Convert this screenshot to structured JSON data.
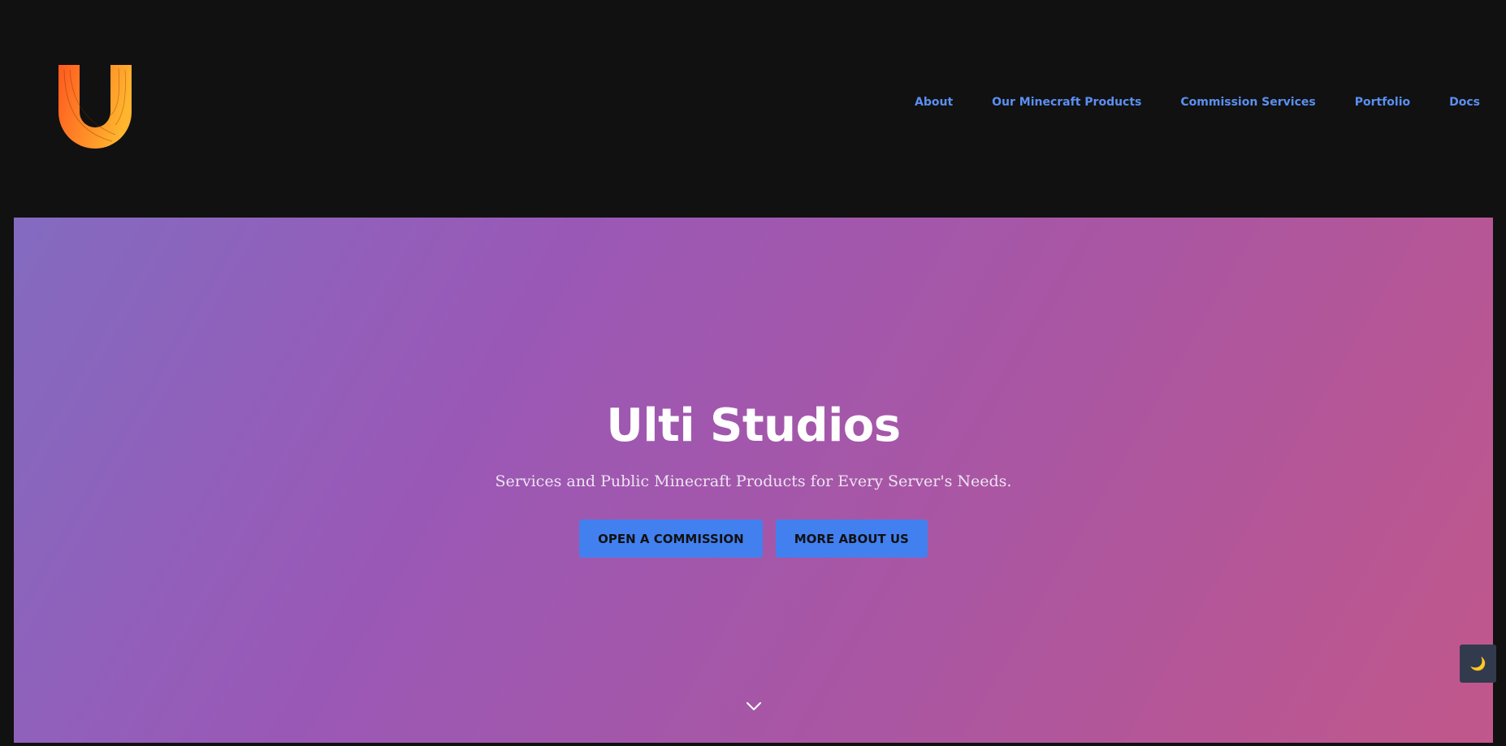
{
  "header": {
    "logo_icon": "ulti-studios-u-logo",
    "brand_colors": [
      "#ff5a1f",
      "#ffb52e"
    ],
    "nav": [
      {
        "label": "About"
      },
      {
        "label": "Our Minecraft Products"
      },
      {
        "label": "Commission Services"
      },
      {
        "label": "Portfolio"
      },
      {
        "label": "Docs"
      }
    ],
    "nav_color": "#5b8ff2"
  },
  "hero": {
    "title": "Ulti Studios",
    "subtitle": "Services and Public Minecraft Products for Every Server's Needs.",
    "buttons": [
      {
        "label": "OPEN A COMMISSION"
      },
      {
        "label": "MORE ABOUT US"
      }
    ],
    "button_color": "#4280f0",
    "gradient": [
      "#836bc0",
      "#9a58b6",
      "#ac56a0",
      "#c1578b"
    ],
    "scroll_icon": "chevron-down-icon"
  },
  "theme_toggle": {
    "icon": "moon-icon",
    "glyph": "🌙"
  }
}
